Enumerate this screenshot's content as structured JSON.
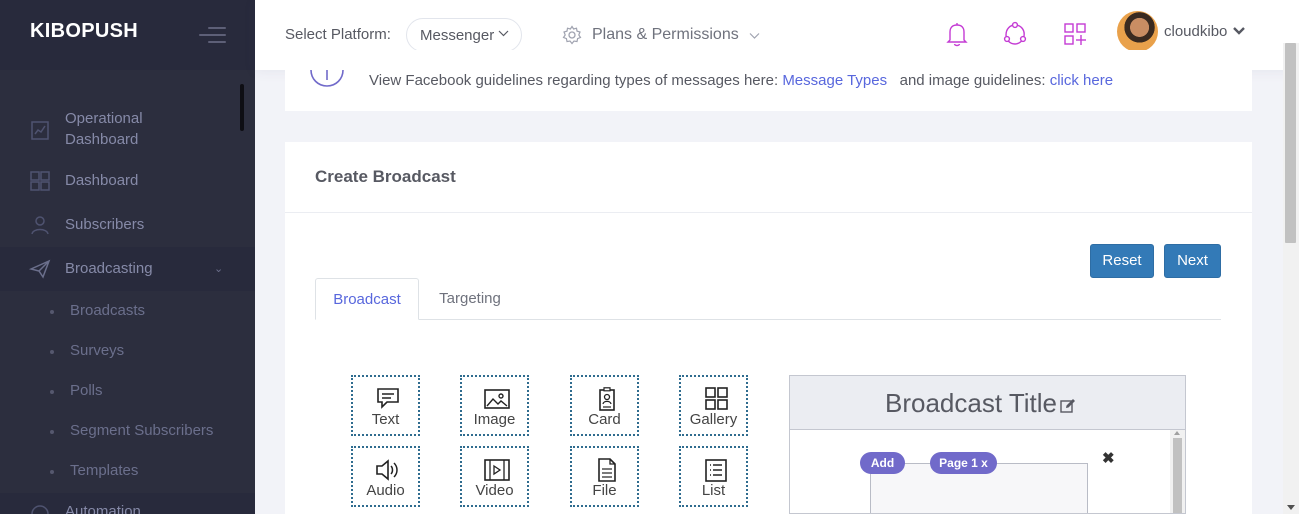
{
  "sidebar": {
    "brand": "KIBOPUSH",
    "items": [
      {
        "label_line1": "Operational",
        "label_line2": "Dashboard",
        "icon": "dashboard-chart-icon"
      },
      {
        "label": "Dashboard",
        "icon": "grid-icon"
      },
      {
        "label": "Subscribers",
        "icon": "user-icon"
      },
      {
        "label": "Broadcasting",
        "icon": "paper-plane-icon"
      }
    ],
    "sub_items": [
      "Broadcasts",
      "Surveys",
      "Polls",
      "Segment Subscribers",
      "Templates"
    ],
    "partial_item": "Automation"
  },
  "header": {
    "select_platform_label": "Select Platform:",
    "platform_value": "Messenger",
    "plans_label": "Plans & Permissions",
    "username": "cloudkibo",
    "icons": [
      "bell-icon",
      "network-icon",
      "apps-add-icon"
    ]
  },
  "info": {
    "text1": "View Facebook guidelines regarding types of messages here:",
    "link1": "Message Types",
    "text2": "and image guidelines:",
    "link2": "click here"
  },
  "card": {
    "title": "Create Broadcast",
    "reset_label": "Reset",
    "next_label": "Next",
    "tabs": [
      "Broadcast",
      "Targeting"
    ],
    "components": [
      "Text",
      "Image",
      "Card",
      "Gallery",
      "Audio",
      "Video",
      "File",
      "List"
    ]
  },
  "preview": {
    "title": "Broadcast Title",
    "add_label": "Add",
    "page_label": "Page 1 x",
    "close_symbol": "✖"
  },
  "colors": {
    "sidebar_bg": "#2c2e3e",
    "accent": "#716aca",
    "link": "#5867dd",
    "button": "#337ab7",
    "icon_purple": "#c43bd4"
  }
}
